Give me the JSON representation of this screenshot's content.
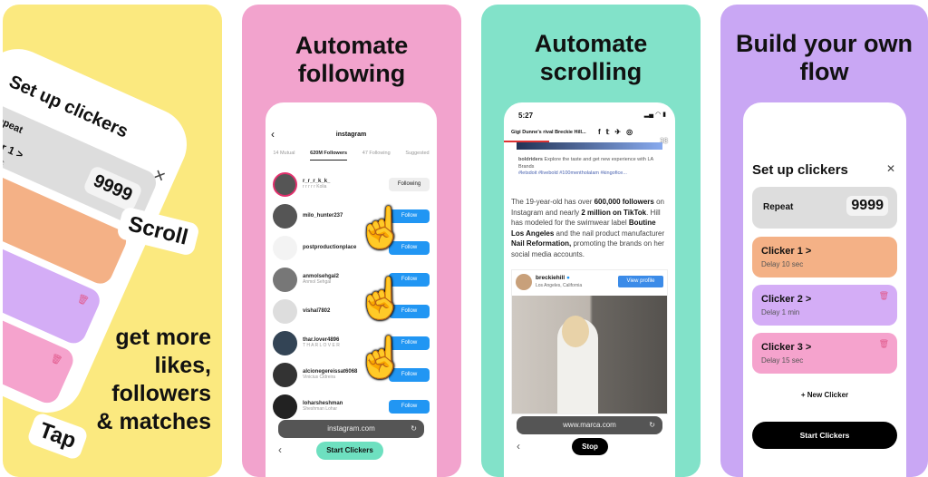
{
  "panel1": {
    "card_title": "Set up clickers",
    "repeat_label": "Repeat",
    "repeat_value": "9999",
    "clicker1_label": "r 1 >",
    "clicker1_delay": "ec",
    "tag_scroll": "Scroll",
    "tag_tap": "Tap",
    "headline": "get more likes, followers & matches",
    "colors": {
      "bg": "#fbe97f"
    }
  },
  "panel2": {
    "headline": "Automate following",
    "title": "instagram",
    "tabs": [
      "14 Mutual",
      "620M Followers",
      "47 Following",
      "Suggested"
    ],
    "rows": [
      {
        "user": "r_r_r_k_k_",
        "sub": "r r r r r Kolia",
        "button": "Following"
      },
      {
        "user": "milo_hunter237",
        "sub": "",
        "button": "Follow"
      },
      {
        "user": "postproductionplace",
        "sub": "",
        "button": "Follow"
      },
      {
        "user": "anmolsehgal2",
        "sub": "Anmol Sehgal",
        "button": "Follow"
      },
      {
        "user": "vishal7802",
        "sub": "",
        "button": "Follow"
      },
      {
        "user": "thar.lover4896",
        "sub": "T H A R  L O V E R",
        "button": "Follow"
      },
      {
        "user": "alcionegereissat6068",
        "sub": "Vinicius Cidreira",
        "button": "Follow"
      },
      {
        "user": "loharsheshman",
        "sub": "Sheshman Lohar",
        "button": "Follow"
      }
    ],
    "url": "instagram.com",
    "start_button": "Start Clickers",
    "colors": {
      "bg": "#f2a3cd",
      "accent": "#6ee0c0"
    }
  },
  "panel3": {
    "headline": "Automate scrolling",
    "time": "5:27",
    "article_header": "Gigi Dunne's rival Breckie Hill...",
    "counter": "38",
    "ad_user": "boldriders",
    "ad_text": "Explore the taste and get new experience with LA Brands",
    "ad_tags": "#letsdoit #livebold #100mentholalam #kingofice...",
    "body_parts": [
      {
        "t": "The 19-year-old has over ",
        "b": false
      },
      {
        "t": "600,000 followers",
        "b": true
      },
      {
        "t": " on Instagram and nearly ",
        "b": false
      },
      {
        "t": "2 million on TikTok",
        "b": true
      },
      {
        "t": ". Hill has modeled for the swimwear label ",
        "b": false
      },
      {
        "t": "Boutine Los Angeles",
        "b": true
      },
      {
        "t": " and the nail product manufacturer ",
        "b": false
      },
      {
        "t": "Nail Reformation,",
        "b": true
      },
      {
        "t": " promoting the brands on her social media accounts.",
        "b": false
      }
    ],
    "embed_user": "breckiehill",
    "embed_location": "Los Angeles, California",
    "view_profile": "View profile",
    "url": "www.marca.com",
    "stop_button": "Stop",
    "colors": {
      "bg": "#82e2c9"
    }
  },
  "panel4": {
    "headline": "Build your own flow",
    "card_title": "Set up clickers",
    "repeat_label": "Repeat",
    "repeat_value": "9999",
    "clickers": [
      {
        "name": "Clicker 1 >",
        "delay": "Delay 10 sec",
        "color": "#f4b186"
      },
      {
        "name": "Clicker 2 >",
        "delay": "Delay 1 min",
        "color": "#d4adf6"
      },
      {
        "name": "Clicker 3 >",
        "delay": "Delay 15 sec",
        "color": "#f5a3cd"
      }
    ],
    "new_clicker": "+ New Clicker",
    "start_button": "Start Clickers",
    "colors": {
      "bg": "#c9a7f4"
    }
  }
}
